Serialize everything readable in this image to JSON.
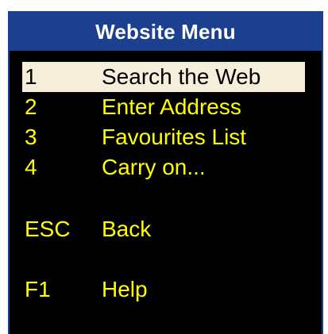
{
  "window": {
    "title": "Website Menu"
  },
  "menu": {
    "items": [
      {
        "key": "1",
        "label": "Search the Web"
      },
      {
        "key": "2",
        "label": "Enter Address"
      },
      {
        "key": "3",
        "label": "Favourites List"
      },
      {
        "key": "4",
        "label": "Carry on..."
      }
    ],
    "back": {
      "key": "ESC",
      "label": "Back"
    },
    "help": {
      "key": "F1",
      "label": "Help"
    },
    "selected_index": 0
  },
  "colors": {
    "title_bar": "#1c3f8f",
    "background": "#000000",
    "item_text": "#ffff00",
    "selected_background": "#f4eedb",
    "selected_text": "#000000",
    "title_text": "#ffffff"
  }
}
